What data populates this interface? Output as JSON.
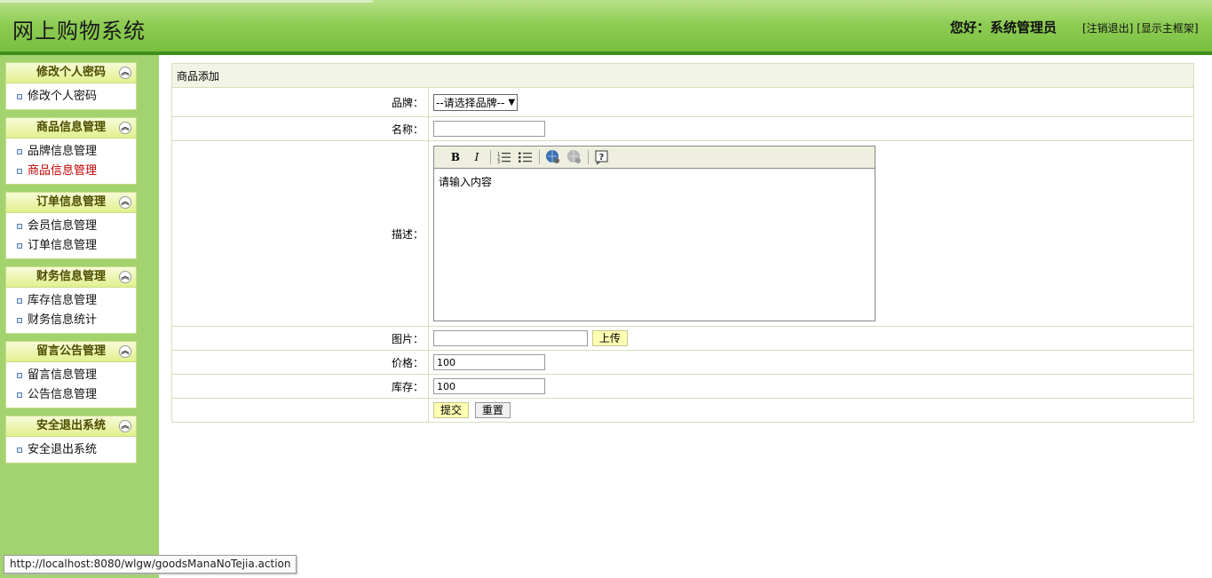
{
  "header": {
    "title": "网上购物系统",
    "greeting": "您好：系统管理员",
    "logout_link": "[注销退出]",
    "show_frame_link": "[显示主框架]"
  },
  "sidebar": {
    "groups": [
      {
        "title": "修改个人密码",
        "items": [
          {
            "label": "修改个人密码"
          }
        ]
      },
      {
        "title": "商品信息管理",
        "items": [
          {
            "label": "品牌信息管理"
          },
          {
            "label": "商品信息管理"
          }
        ]
      },
      {
        "title": "订单信息管理",
        "items": [
          {
            "label": "会员信息管理"
          },
          {
            "label": "订单信息管理"
          }
        ]
      },
      {
        "title": "财务信息管理",
        "items": [
          {
            "label": "库存信息管理"
          },
          {
            "label": "财务信息统计"
          }
        ]
      },
      {
        "title": "留言公告管理",
        "items": [
          {
            "label": "留言信息管理"
          },
          {
            "label": "公告信息管理"
          }
        ]
      },
      {
        "title": "安全退出系统",
        "items": [
          {
            "label": "安全退出系统"
          }
        ]
      }
    ],
    "active_item": "商品信息管理"
  },
  "form": {
    "caption": "商品添加",
    "brand_label": "品牌：",
    "brand_selected": "--请选择品牌--",
    "name_label": "名称：",
    "name_value": "",
    "desc_label": "描述：",
    "desc_text": "请输入内容",
    "image_label": "图片：",
    "image_value": "",
    "upload_button": "上传",
    "price_label": "价格：",
    "price_value": "100",
    "stock_label": "库存：",
    "stock_value": "100",
    "submit_button": "提交",
    "reset_button": "重置"
  },
  "editor_toolbar": {
    "bold": "B",
    "italic": "I",
    "icons": [
      "bold-icon",
      "italic-icon",
      "ordered-list-icon",
      "unordered-list-icon",
      "insert-link-icon",
      "remove-link-icon",
      "help-icon"
    ]
  },
  "statusbar": {
    "url": "http://localhost:8080/wlgw/goodsManaNoTejia.action"
  },
  "colors": {
    "header_green": "#78bf3f",
    "sidebar_green": "#a2d36f",
    "active_red": "#c00000"
  }
}
